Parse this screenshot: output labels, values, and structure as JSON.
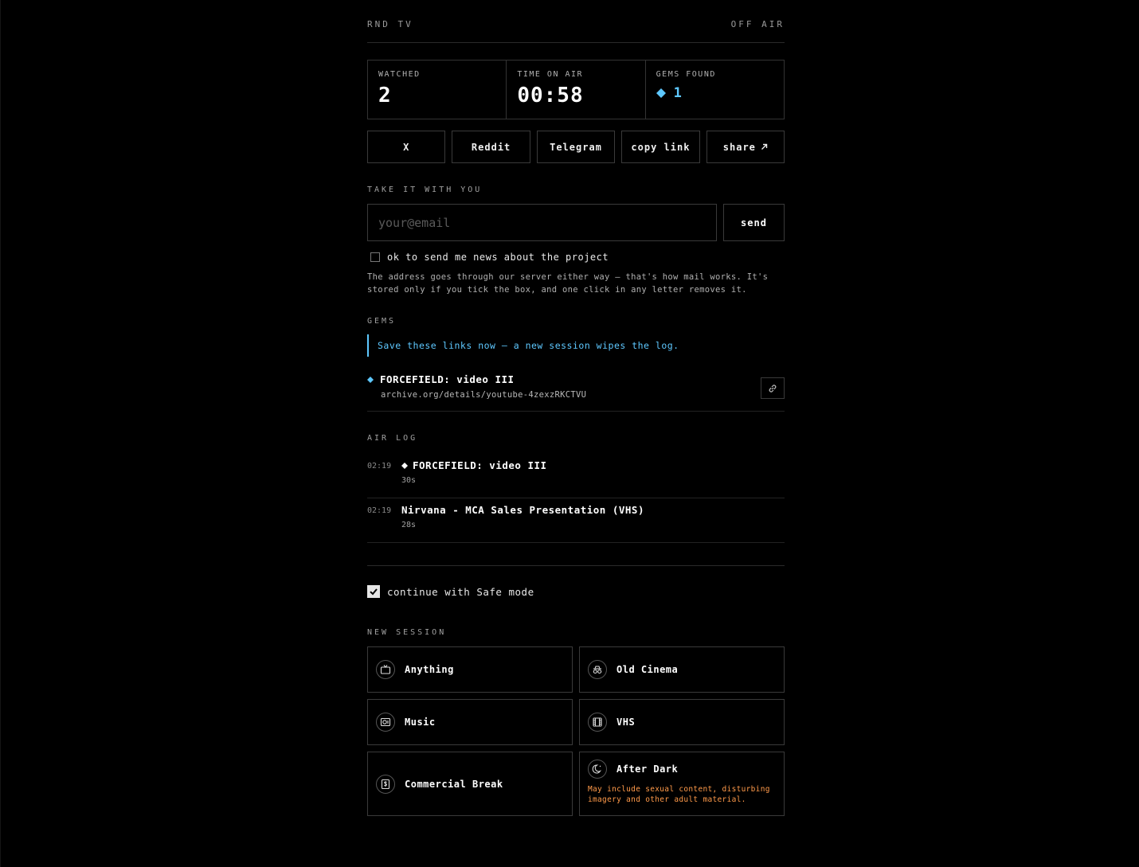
{
  "header": {
    "brand": "RND TV",
    "status": "OFF AIR"
  },
  "stats": {
    "watched_label": "WATCHED",
    "watched_value": "2",
    "time_label": "TIME ON AIR",
    "time_value": "00:58",
    "gems_label": "GEMS FOUND",
    "gems_value": "1"
  },
  "share": {
    "x": "X",
    "reddit": "Reddit",
    "telegram": "Telegram",
    "copy_link": "copy link",
    "share": "share"
  },
  "email": {
    "section_label": "TAKE IT WITH YOU",
    "placeholder": "your@email",
    "send": "send",
    "consent": "ok to send me news about the project",
    "notice": "The address goes through our server either way — that's how mail works. It's stored only if you tick the box, and one click in any letter removes it."
  },
  "gems": {
    "section_label": "GEMS",
    "callout": "Save these links now — a new session wipes the log.",
    "items": [
      {
        "title": "FORCEFIELD: video III",
        "url": "archive.org/details/youtube-4zexzRKCTVU"
      }
    ]
  },
  "air_log": {
    "section_label": "AIR LOG",
    "items": [
      {
        "time": "02:19",
        "title": "FORCEFIELD: video III",
        "duration": "30s",
        "gem": true
      },
      {
        "time": "02:19",
        "title": "Nirvana - MCA Sales Presentation (VHS)",
        "duration": "28s",
        "gem": false
      }
    ]
  },
  "safe_mode": {
    "label": "continue with Safe mode",
    "checked": true
  },
  "new_session": {
    "section_label": "NEW SESSION",
    "options": [
      {
        "label": "Anything",
        "icon": "tv-icon"
      },
      {
        "label": "Old Cinema",
        "icon": "glasses-icon"
      },
      {
        "label": "Music",
        "icon": "speaker-icon"
      },
      {
        "label": "VHS",
        "icon": "film-icon"
      },
      {
        "label": "Commercial Break",
        "icon": "dollar-icon"
      },
      {
        "label": "After Dark",
        "icon": "moon-icon",
        "warning": "May include sexual content, disturbing imagery and other adult material."
      }
    ]
  },
  "colors": {
    "accent": "#5ec8ff",
    "warning": "#ff9a4a",
    "background": "#000000"
  }
}
